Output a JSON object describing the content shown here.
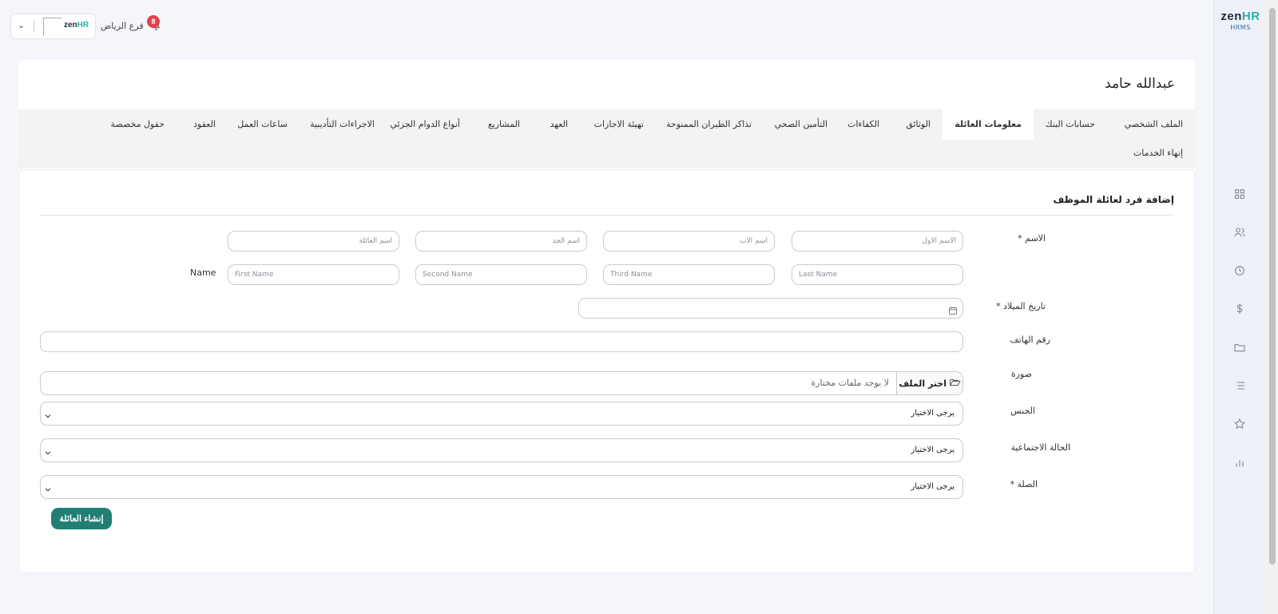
{
  "brand": {
    "logo_main": "zen",
    "logo_accent": "HR",
    "subtitle": "HRMS"
  },
  "topbar": {
    "branch": "فرع الرياض",
    "notification_count": "8",
    "mini_logo_main": "zen",
    "mini_logo_accent": "HR"
  },
  "sidebar_icons": [
    "dashboard-icon",
    "users-icon",
    "clock-icon",
    "dollar-icon",
    "folder-icon",
    "list-icon",
    "star-icon",
    "chart-icon"
  ],
  "employee": {
    "name": "عبدالله حامد"
  },
  "tabs": [
    {
      "label": "الملف الشخصي"
    },
    {
      "label": "حسابات البنك"
    },
    {
      "label": "معلومات العائلة",
      "active": true
    },
    {
      "label": "الوثائق"
    },
    {
      "label": "الكفاءات"
    },
    {
      "label": "التأمين الصحي"
    },
    {
      "label": "تذاكر الطيران الممنوحة"
    },
    {
      "label": "تهيئة الاجازات"
    },
    {
      "label": "العهد"
    },
    {
      "label": "المشاريع"
    },
    {
      "label": "أنواع الدوام الجزئي"
    },
    {
      "label": "الاجراءات التأديبية"
    },
    {
      "label": "ساعات العمل"
    },
    {
      "label": "العقود"
    },
    {
      "label": "حقول مخصصة"
    },
    {
      "label": "إنهاء الخدمات"
    }
  ],
  "form": {
    "title": "إضافة فرد لعائلة الموظف",
    "name_label": "الاسم *",
    "name_ar": {
      "first_placeholder": "الاسم الأول",
      "father_placeholder": "اسم الأب",
      "grandfather_placeholder": "اسم الجد",
      "family_placeholder": "اسم العائلة"
    },
    "name_en_label": "Name",
    "name_en": {
      "last_placeholder": "Last Name",
      "third_placeholder": "Third Name",
      "second_placeholder": "Second Name",
      "first_placeholder": "First Name"
    },
    "birth_date_label": "تاريخ الميلاد *",
    "phone_label": "رقم الهاتف",
    "photo_label": "صورة",
    "file_button": "اختر الملف",
    "file_status": "لا يوجد ملفات مختارة",
    "gender_label": "الجنس",
    "gender_value": "يرجى الاختيار",
    "marital_label": "الحالة الاجتماعية",
    "marital_value": "يرجى الاختيار",
    "relation_label": "الصلة *",
    "relation_value": "يرجى الاختيار",
    "submit_button": "إنشاء العائلة"
  },
  "colors": {
    "primary_button": "#217e74",
    "badge": "#e0434b",
    "accent": "#27b3a8"
  }
}
